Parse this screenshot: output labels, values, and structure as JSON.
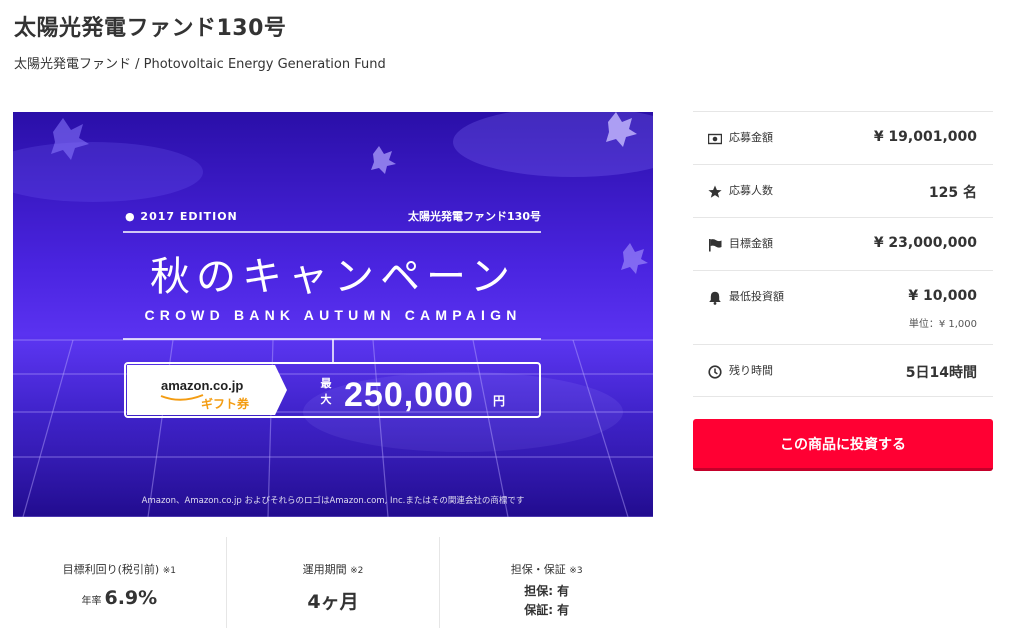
{
  "header": {
    "title": "太陽光発電ファンド130号",
    "subtitle": "太陽光発電ファンド / Photovoltaic Energy Generation Fund"
  },
  "banner": {
    "edition": "● 2017 EDITION",
    "fund_name": "太陽光発電ファンド130号",
    "campaign_title": "秋のキャンペーン",
    "campaign_subtitle": "CROWD BANK AUTUMN CAMPAIGN",
    "amazon_logo": "amazon.co.jp",
    "gift_label": "ギフト券",
    "max_top": "最",
    "max_bottom": "大",
    "amount": "250,000",
    "unit": "円",
    "disclaimer": "Amazon、Amazon.co.jp およびそれらのロゴはAmazon.com, Inc.またはその関連会社の商標です"
  },
  "stats": [
    {
      "icon": "money-icon",
      "label": "応募金額",
      "value": "¥ 19,001,000"
    },
    {
      "icon": "star-icon",
      "label": "応募人数",
      "value": "125 名"
    },
    {
      "icon": "flag-icon",
      "label": "目標金額",
      "value": "¥ 23,000,000"
    },
    {
      "icon": "bell-icon",
      "label": "最低投資額",
      "value": "¥ 10,000",
      "sub": "単位：¥ 1,000"
    },
    {
      "icon": "clock-icon",
      "label": "残り時間",
      "value": "5日14時間"
    }
  ],
  "invest_button": "この商品に投資する",
  "info": {
    "yield": {
      "label": "目標利回り(税引前)",
      "note": "※1",
      "prefix": "年率",
      "value": "6.9%"
    },
    "period": {
      "label": "運用期間",
      "note": "※2",
      "value": "4ヶ月"
    },
    "collateral": {
      "label": "担保・保証",
      "note": "※3",
      "line1": "担保: 有",
      "line2": "保証: 有"
    }
  },
  "colors": {
    "accent": "#ff0033",
    "banner": "#4a24e0"
  }
}
